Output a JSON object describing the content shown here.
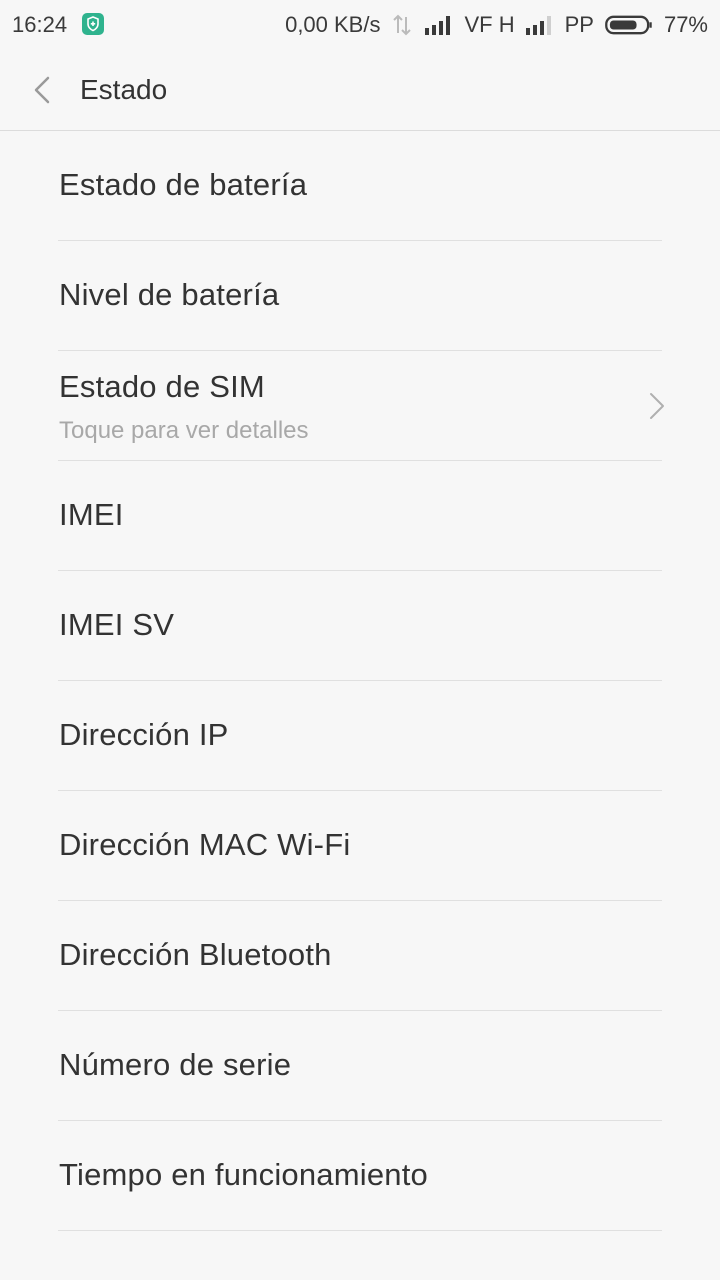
{
  "status_bar": {
    "time": "16:24",
    "speed": "0,00 KB/s",
    "carrier1": "VF H",
    "carrier2": "PP",
    "battery_percent": "77%",
    "battery_level": 0.77,
    "shield_color": "#2fb38e"
  },
  "header": {
    "title": "Estado",
    "back_icon": "chevron-left-icon"
  },
  "items": [
    {
      "title": "Estado de batería"
    },
    {
      "title": "Nivel de batería"
    },
    {
      "title": "Estado de SIM",
      "subtitle": "Toque para ver detalles",
      "chevron": "chevron-right-icon"
    },
    {
      "title": "IMEI"
    },
    {
      "title": "IMEI SV"
    },
    {
      "title": "Dirección IP"
    },
    {
      "title": "Dirección MAC Wi-Fi"
    },
    {
      "title": "Dirección Bluetooth"
    },
    {
      "title": "Número de serie"
    },
    {
      "title": "Tiempo en funcionamiento"
    }
  ]
}
